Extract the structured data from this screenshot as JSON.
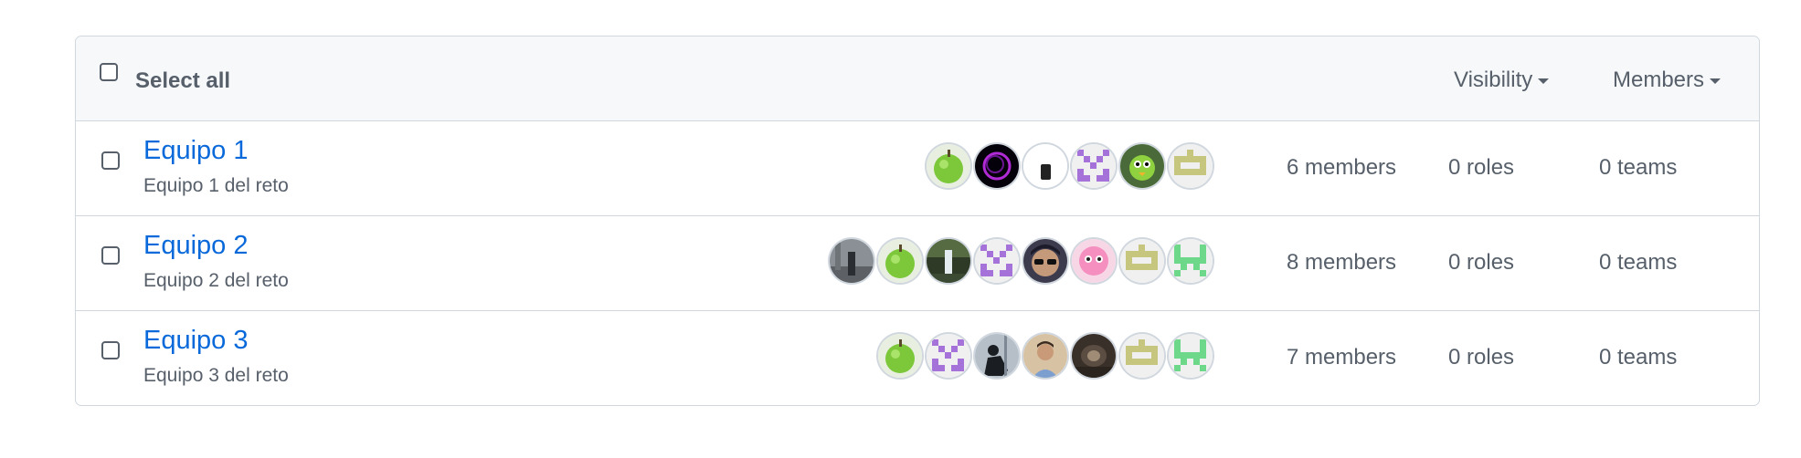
{
  "header": {
    "select_all_label": "Select all",
    "filters": {
      "visibility_label": "Visibility",
      "members_label": "Members"
    }
  },
  "teams": [
    {
      "name": "Equipo 1",
      "description": "Equipo 1 del reto",
      "members_label": "6 members",
      "roles_label": "0 roles",
      "teams_label": "0 teams",
      "avatars": [
        "green-apple",
        "dark-swirl",
        "white-device",
        "purple-identicon",
        "green-bird",
        "olive-identicon"
      ]
    },
    {
      "name": "Equipo 2",
      "description": "Equipo 2 del reto",
      "members_label": "8 members",
      "roles_label": "0 roles",
      "teams_label": "0 teams",
      "avatars": [
        "street-photo",
        "green-apple",
        "waterfall-photo",
        "purple-identicon",
        "sunglasses-portrait",
        "pink-anime",
        "olive-identicon",
        "green-identicon"
      ]
    },
    {
      "name": "Equipo 3",
      "description": "Equipo 3 del reto",
      "members_label": "7 members",
      "roles_label": "0 roles",
      "teams_label": "0 teams",
      "avatars": [
        "green-apple",
        "purple-identicon",
        "silhouette-photo",
        "man-portrait",
        "tunnel-photo",
        "olive-identicon",
        "green-identicon"
      ]
    }
  ],
  "colors": {
    "link": "#0969da",
    "muted_text": "#57606a",
    "border": "#d0d7de",
    "header_bg": "#f6f8fa",
    "identicon_purple": "#a472d8",
    "identicon_olive": "#c6c67e",
    "identicon_green": "#6ed88a"
  }
}
